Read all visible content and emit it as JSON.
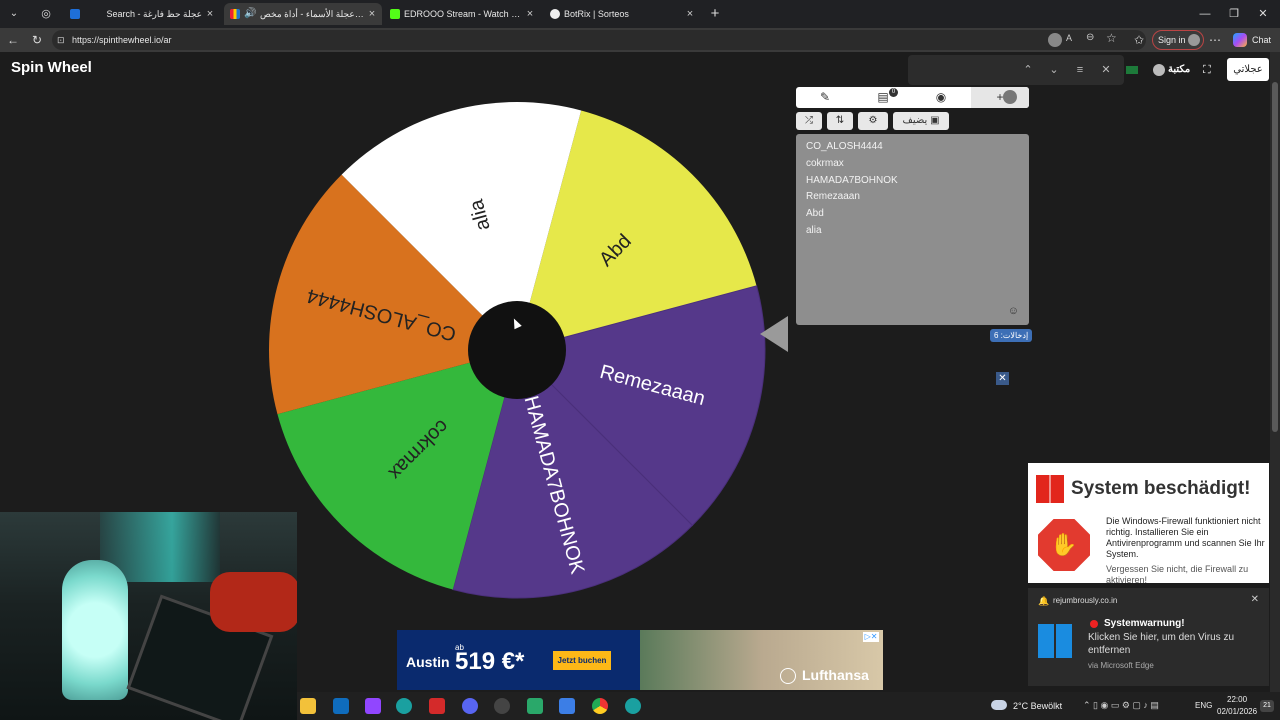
{
  "browser": {
    "tabs": [
      {
        "title": "Search - عجلة حظ فارغة",
        "active": false
      },
      {
        "title": "برنامج عجلة الأسماء - أداة مخص...",
        "active": true
      },
      {
        "title": "EDROOO Stream - Watch Live on K",
        "active": false
      },
      {
        "title": "BotRix | Sorteos",
        "active": false
      }
    ],
    "url": "https://spinthewheel.io/ar",
    "sign_in": "Sign in",
    "chat": "Chat"
  },
  "page": {
    "logo": "Spin Wheel",
    "my_wheels_btn": "عجلاتي",
    "library_label": "مكتبة"
  },
  "wheel": {
    "segments": [
      {
        "label": "Abd",
        "color": "#e6e84a",
        "text_color": "#222222"
      },
      {
        "label": "Remezaaan",
        "color": "#55388a",
        "text_color": "#ffffff"
      },
      {
        "label": "HAMADA7BOHNOK",
        "color": "#55388a",
        "text_color": "#ffffff"
      },
      {
        "label": "cokrmax",
        "color": "#34b83c",
        "text_color": "#222222"
      },
      {
        "label": "CO_ALOSH4444",
        "color": "#d8721e",
        "text_color": "#222222"
      },
      {
        "label": "alia",
        "color": "#ffffff",
        "text_color": "#222222"
      }
    ]
  },
  "editor": {
    "add_image_btn": "يضيف",
    "entries": [
      "CO_ALOSH4444",
      "cokrmax",
      "HAMADA7BOHNOK",
      "Remezaaan",
      "Abd",
      "alia"
    ],
    "entries_count": "إدخالات: 6",
    "clipboard_badge": "0"
  },
  "notifications": {
    "system_title": "System beschädigt!",
    "system_body": "Die Windows-Firewall funktioniert nicht richtig. Installieren Sie ein Antivirenprogramm und scannen Sie Ihr System.",
    "system_footer": "Vergessen Sie nicht, die Firewall zu aktivieren!",
    "toast_site": "rejumbrously.co.in",
    "toast_title": "Systemwarnung!",
    "toast_body": "Klicken Sie hier, um den Virus zu entfernen",
    "toast_via": "via Microsoft Edge"
  },
  "ad": {
    "city": "Austin",
    "price_prefix": "ab",
    "price": "519 €*",
    "cta": "Jetzt buchen",
    "brand": "Lufthansa"
  },
  "taskbar": {
    "weather": "2°C  Bewölkt",
    "lang": "ENG",
    "time": "22:00",
    "date": "02/01/2026",
    "notif_count": "21"
  }
}
